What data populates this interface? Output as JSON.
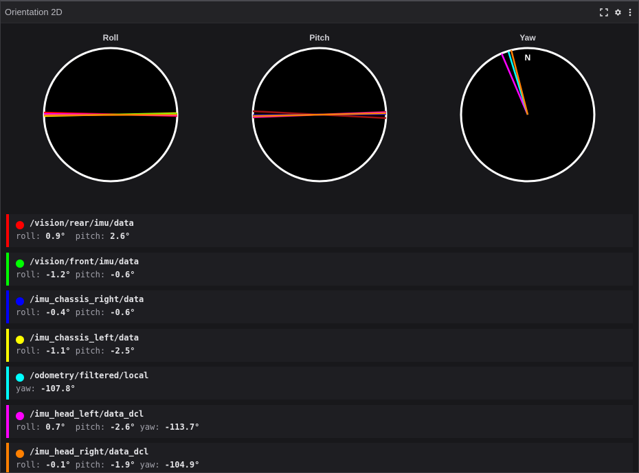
{
  "panel": {
    "title": "Orientation 2D"
  },
  "gauges": [
    {
      "label": "Roll"
    },
    {
      "label": "Pitch"
    },
    {
      "label": "Yaw",
      "north": "N"
    }
  ],
  "topics": [
    {
      "name": "/vision/rear/imu/data",
      "color": "#ff0000",
      "parts": [
        {
          "k": "roll: ",
          "v": "0.9°",
          "sep": "  "
        },
        {
          "k": "pitch: ",
          "v": "2.6°",
          "sep": ""
        }
      ]
    },
    {
      "name": "/vision/front/imu/data",
      "color": "#00ff00",
      "parts": [
        {
          "k": "roll: ",
          "v": "-1.2°",
          "sep": " "
        },
        {
          "k": "pitch: ",
          "v": "-0.6°",
          "sep": ""
        }
      ]
    },
    {
      "name": "/imu_chassis_right/data",
      "color": "#0000ff",
      "parts": [
        {
          "k": "roll: ",
          "v": "-0.4°",
          "sep": " "
        },
        {
          "k": "pitch: ",
          "v": "-0.6°",
          "sep": ""
        }
      ]
    },
    {
      "name": "/imu_chassis_left/data",
      "color": "#ffff00",
      "parts": [
        {
          "k": "roll: ",
          "v": "-1.1°",
          "sep": " "
        },
        {
          "k": "pitch: ",
          "v": "-2.5°",
          "sep": ""
        }
      ]
    },
    {
      "name": "/odometry/filtered/local",
      "color": "#00ffff",
      "parts": [
        {
          "k": "yaw: ",
          "v": "-107.8°",
          "sep": ""
        }
      ]
    },
    {
      "name": "/imu_head_left/data_dcl",
      "color": "#ff00ff",
      "parts": [
        {
          "k": "roll: ",
          "v": "0.7°",
          "sep": "  "
        },
        {
          "k": "pitch: ",
          "v": "-2.6°",
          "sep": " "
        },
        {
          "k": "yaw: ",
          "v": "-113.7°",
          "sep": ""
        }
      ]
    },
    {
      "name": "/imu_head_right/data_dcl",
      "color": "#ff8000",
      "parts": [
        {
          "k": "roll: ",
          "v": "-0.1°",
          "sep": " "
        },
        {
          "k": "pitch: ",
          "v": "-1.9°",
          "sep": " "
        },
        {
          "k": "yaw: ",
          "v": "-104.9°",
          "sep": ""
        }
      ]
    }
  ]
}
